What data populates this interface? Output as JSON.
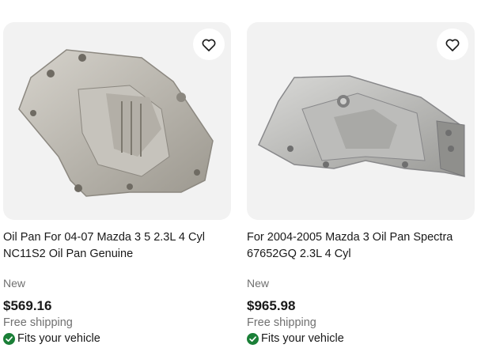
{
  "listings": [
    {
      "title": "Oil Pan For 04-07 Mazda 3 5 2.3L 4 Cyl NC11S2 Oil Pan Genuine",
      "image_icon": "oil-pan-image",
      "condition": "New",
      "price": "$569.16",
      "shipping": "Free shipping",
      "fitment": "Fits your vehicle"
    },
    {
      "title": "For 2004-2005 Mazda 3 Oil Pan Spectra 67652GQ 2.3L 4 Cyl",
      "image_icon": "oil-pan-image",
      "condition": "New",
      "price": "$965.98",
      "shipping": "Free shipping",
      "fitment": "Fits your vehicle"
    }
  ],
  "icons": {
    "watch": "heart-icon",
    "fitment": "check-circle-icon"
  },
  "colors": {
    "image_background": "#f2f2f2",
    "fitment_check": "#1a7f37",
    "secondary_text": "#707070"
  }
}
